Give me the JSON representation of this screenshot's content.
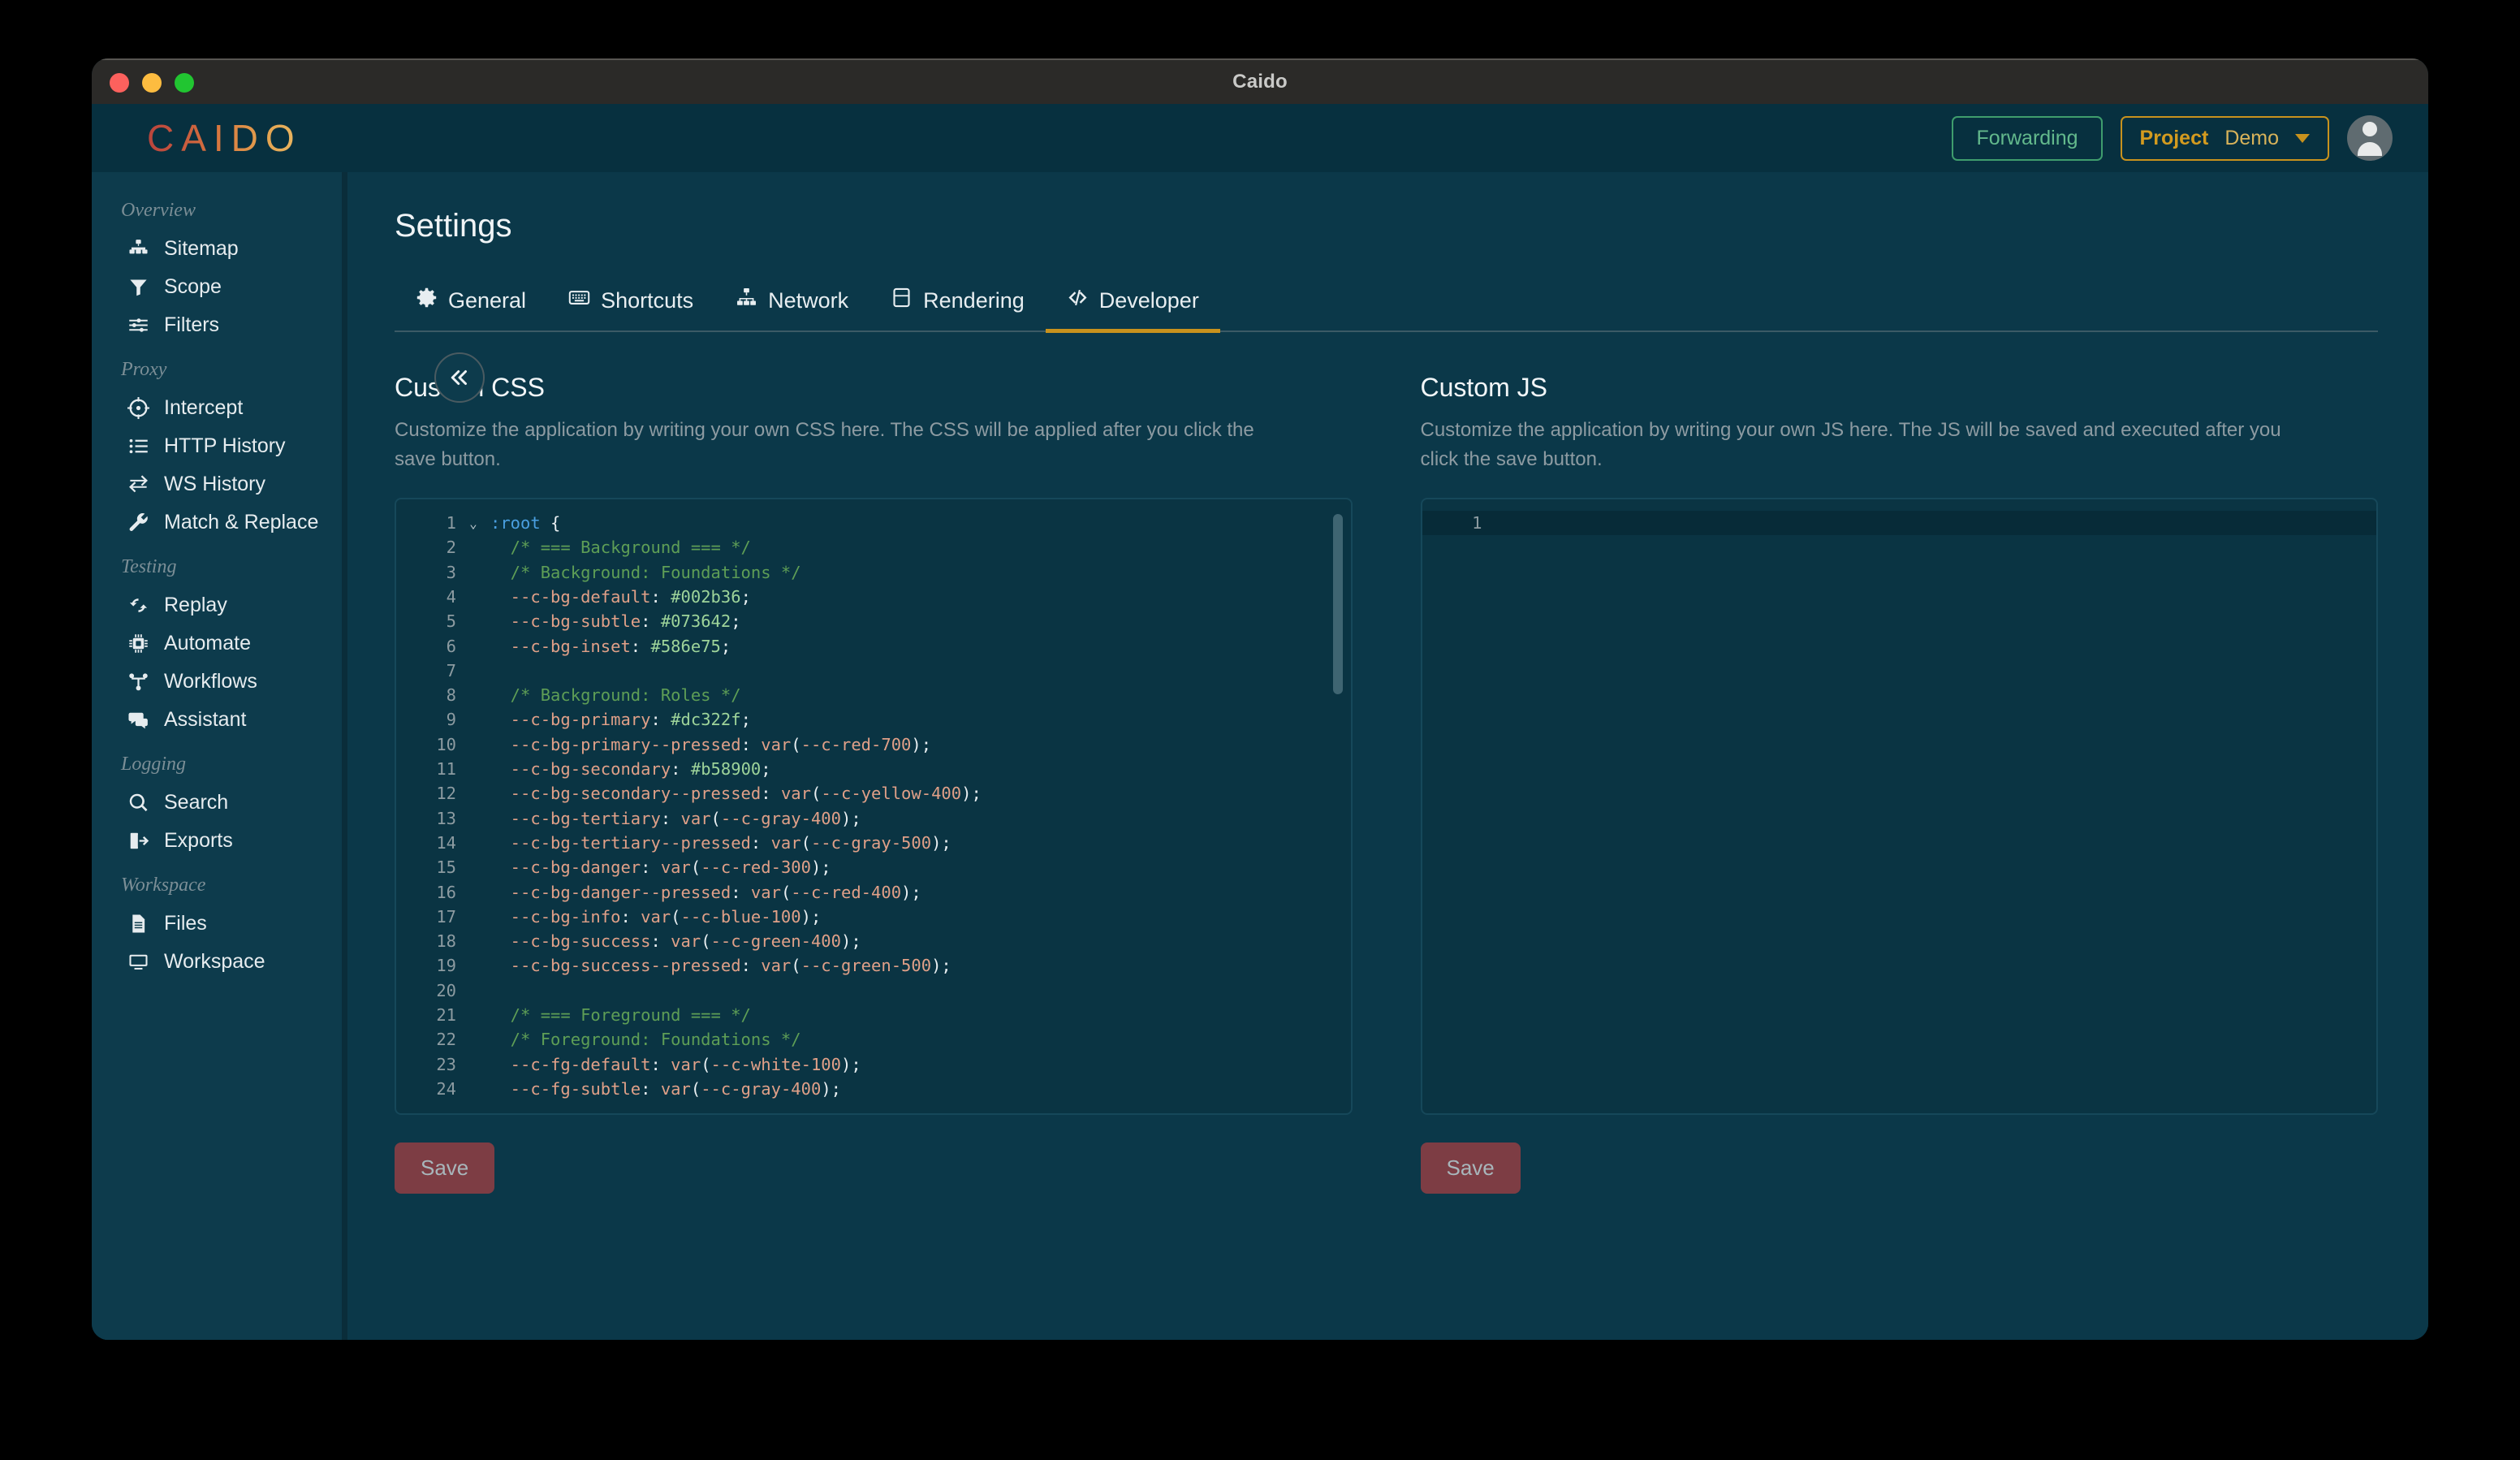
{
  "window": {
    "title": "Caido",
    "traffic_lights": [
      "close-red",
      "minimize-yellow",
      "maximize-green"
    ]
  },
  "header": {
    "logo_text": "CAIDO",
    "forwarding_label": "Forwarding",
    "project_label": "Project",
    "project_value": "Demo",
    "avatar_icon": "user-avatar-icon",
    "colors": {
      "forwarding_border": "#3f9d6d",
      "forwarding_text": "#63b98c",
      "project_border": "#c8921d",
      "project_key": "#d39b1f",
      "project_value": "#d8b35a"
    }
  },
  "sidebar": {
    "collapse_label": "«",
    "groups": [
      {
        "label": "Overview",
        "items": [
          {
            "label": "Sitemap",
            "icon": "sitemap-icon"
          },
          {
            "label": "Scope",
            "icon": "funnel-icon"
          },
          {
            "label": "Filters",
            "icon": "sliders-icon"
          }
        ]
      },
      {
        "label": "Proxy",
        "items": [
          {
            "label": "Intercept",
            "icon": "crosshair-icon"
          },
          {
            "label": "HTTP History",
            "icon": "list-icon"
          },
          {
            "label": "WS History",
            "icon": "exchange-arrows-icon"
          },
          {
            "label": "Match & Replace",
            "icon": "wrench-icon"
          }
        ]
      },
      {
        "label": "Testing",
        "items": [
          {
            "label": "Replay",
            "icon": "refresh-icon"
          },
          {
            "label": "Automate",
            "icon": "chip-icon"
          },
          {
            "label": "Workflows",
            "icon": "workflow-icon"
          },
          {
            "label": "Assistant",
            "icon": "chat-bubbles-icon"
          }
        ]
      },
      {
        "label": "Logging",
        "items": [
          {
            "label": "Search",
            "icon": "search-icon"
          },
          {
            "label": "Exports",
            "icon": "export-icon"
          }
        ]
      },
      {
        "label": "Workspace",
        "items": [
          {
            "label": "Files",
            "icon": "file-icon"
          },
          {
            "label": "Workspace",
            "icon": "monitor-icon"
          }
        ]
      }
    ]
  },
  "main": {
    "page_title": "Settings",
    "tabs": [
      {
        "label": "General",
        "icon": "gear-icon",
        "active": false
      },
      {
        "label": "Shortcuts",
        "icon": "keyboard-icon",
        "active": false
      },
      {
        "label": "Network",
        "icon": "network-icon",
        "active": false
      },
      {
        "label": "Rendering",
        "icon": "window-icon",
        "active": false
      },
      {
        "label": "Developer",
        "icon": "code-tags-icon",
        "active": true
      }
    ],
    "active_tab": "Developer",
    "active_tab_underline_color": "#c8921d",
    "panels": [
      {
        "title": "Custom CSS",
        "description": "Customize the application by writing your own CSS here. The CSS will be applied after you click the save button.",
        "save_label": "Save",
        "scrollbar_visible": true,
        "lines": [
          {
            "n": 1,
            "fold": "⌄",
            "tokens": [
              {
                "t": ":root",
                "c": "c-sel"
              },
              {
                "t": " {",
                "c": "c-punc"
              }
            ]
          },
          {
            "n": 2,
            "fold": "",
            "tokens": [
              {
                "t": "  /* === Background === */",
                "c": "c-com"
              }
            ]
          },
          {
            "n": 3,
            "fold": "",
            "tokens": [
              {
                "t": "  /* Background: Foundations */",
                "c": "c-com"
              }
            ]
          },
          {
            "n": 4,
            "fold": "",
            "tokens": [
              {
                "t": "  --c-bg-default",
                "c": "c-var"
              },
              {
                "t": ": ",
                "c": "c-punc"
              },
              {
                "t": "#002b36",
                "c": "c-val"
              },
              {
                "t": ";",
                "c": "c-punc"
              }
            ]
          },
          {
            "n": 5,
            "fold": "",
            "tokens": [
              {
                "t": "  --c-bg-subtle",
                "c": "c-var"
              },
              {
                "t": ": ",
                "c": "c-punc"
              },
              {
                "t": "#073642",
                "c": "c-val"
              },
              {
                "t": ";",
                "c": "c-punc"
              }
            ]
          },
          {
            "n": 6,
            "fold": "",
            "tokens": [
              {
                "t": "  --c-bg-inset",
                "c": "c-var"
              },
              {
                "t": ": ",
                "c": "c-punc"
              },
              {
                "t": "#586e75",
                "c": "c-val"
              },
              {
                "t": ";",
                "c": "c-punc"
              }
            ]
          },
          {
            "n": 7,
            "fold": "",
            "tokens": []
          },
          {
            "n": 8,
            "fold": "",
            "tokens": [
              {
                "t": "  /* Background: Roles */",
                "c": "c-com"
              }
            ]
          },
          {
            "n": 9,
            "fold": "",
            "tokens": [
              {
                "t": "  --c-bg-primary",
                "c": "c-var"
              },
              {
                "t": ": ",
                "c": "c-punc"
              },
              {
                "t": "#dc322f",
                "c": "c-val"
              },
              {
                "t": ";",
                "c": "c-punc"
              }
            ]
          },
          {
            "n": 10,
            "fold": "",
            "tokens": [
              {
                "t": "  --c-bg-primary--pressed",
                "c": "c-var"
              },
              {
                "t": ": ",
                "c": "c-punc"
              },
              {
                "t": "var",
                "c": "c-fn"
              },
              {
                "t": "(",
                "c": "c-punc"
              },
              {
                "t": "--c-red-700",
                "c": "c-var"
              },
              {
                "t": ");",
                "c": "c-punc"
              }
            ]
          },
          {
            "n": 11,
            "fold": "",
            "tokens": [
              {
                "t": "  --c-bg-secondary",
                "c": "c-var"
              },
              {
                "t": ": ",
                "c": "c-punc"
              },
              {
                "t": "#b58900",
                "c": "c-val"
              },
              {
                "t": ";",
                "c": "c-punc"
              }
            ]
          },
          {
            "n": 12,
            "fold": "",
            "tokens": [
              {
                "t": "  --c-bg-secondary--pressed",
                "c": "c-var"
              },
              {
                "t": ": ",
                "c": "c-punc"
              },
              {
                "t": "var",
                "c": "c-fn"
              },
              {
                "t": "(",
                "c": "c-punc"
              },
              {
                "t": "--c-yellow-400",
                "c": "c-var"
              },
              {
                "t": ");",
                "c": "c-punc"
              }
            ]
          },
          {
            "n": 13,
            "fold": "",
            "tokens": [
              {
                "t": "  --c-bg-tertiary",
                "c": "c-var"
              },
              {
                "t": ": ",
                "c": "c-punc"
              },
              {
                "t": "var",
                "c": "c-fn"
              },
              {
                "t": "(",
                "c": "c-punc"
              },
              {
                "t": "--c-gray-400",
                "c": "c-var"
              },
              {
                "t": ");",
                "c": "c-punc"
              }
            ]
          },
          {
            "n": 14,
            "fold": "",
            "tokens": [
              {
                "t": "  --c-bg-tertiary--pressed",
                "c": "c-var"
              },
              {
                "t": ": ",
                "c": "c-punc"
              },
              {
                "t": "var",
                "c": "c-fn"
              },
              {
                "t": "(",
                "c": "c-punc"
              },
              {
                "t": "--c-gray-500",
                "c": "c-var"
              },
              {
                "t": ");",
                "c": "c-punc"
              }
            ]
          },
          {
            "n": 15,
            "fold": "",
            "tokens": [
              {
                "t": "  --c-bg-danger",
                "c": "c-var"
              },
              {
                "t": ": ",
                "c": "c-punc"
              },
              {
                "t": "var",
                "c": "c-fn"
              },
              {
                "t": "(",
                "c": "c-punc"
              },
              {
                "t": "--c-red-300",
                "c": "c-var"
              },
              {
                "t": ");",
                "c": "c-punc"
              }
            ]
          },
          {
            "n": 16,
            "fold": "",
            "tokens": [
              {
                "t": "  --c-bg-danger--pressed",
                "c": "c-var"
              },
              {
                "t": ": ",
                "c": "c-punc"
              },
              {
                "t": "var",
                "c": "c-fn"
              },
              {
                "t": "(",
                "c": "c-punc"
              },
              {
                "t": "--c-red-400",
                "c": "c-var"
              },
              {
                "t": ");",
                "c": "c-punc"
              }
            ]
          },
          {
            "n": 17,
            "fold": "",
            "tokens": [
              {
                "t": "  --c-bg-info",
                "c": "c-var"
              },
              {
                "t": ": ",
                "c": "c-punc"
              },
              {
                "t": "var",
                "c": "c-fn"
              },
              {
                "t": "(",
                "c": "c-punc"
              },
              {
                "t": "--c-blue-100",
                "c": "c-var"
              },
              {
                "t": ");",
                "c": "c-punc"
              }
            ]
          },
          {
            "n": 18,
            "fold": "",
            "tokens": [
              {
                "t": "  --c-bg-success",
                "c": "c-var"
              },
              {
                "t": ": ",
                "c": "c-punc"
              },
              {
                "t": "var",
                "c": "c-fn"
              },
              {
                "t": "(",
                "c": "c-punc"
              },
              {
                "t": "--c-green-400",
                "c": "c-var"
              },
              {
                "t": ");",
                "c": "c-punc"
              }
            ]
          },
          {
            "n": 19,
            "fold": "",
            "tokens": [
              {
                "t": "  --c-bg-success--pressed",
                "c": "c-var"
              },
              {
                "t": ": ",
                "c": "c-punc"
              },
              {
                "t": "var",
                "c": "c-fn"
              },
              {
                "t": "(",
                "c": "c-punc"
              },
              {
                "t": "--c-green-500",
                "c": "c-var"
              },
              {
                "t": ");",
                "c": "c-punc"
              }
            ]
          },
          {
            "n": 20,
            "fold": "",
            "tokens": []
          },
          {
            "n": 21,
            "fold": "",
            "tokens": [
              {
                "t": "  /* === Foreground === */",
                "c": "c-com"
              }
            ]
          },
          {
            "n": 22,
            "fold": "",
            "tokens": [
              {
                "t": "  /* Foreground: Foundations */",
                "c": "c-com"
              }
            ]
          },
          {
            "n": 23,
            "fold": "",
            "tokens": [
              {
                "t": "  --c-fg-default",
                "c": "c-var"
              },
              {
                "t": ": ",
                "c": "c-punc"
              },
              {
                "t": "var",
                "c": "c-fn"
              },
              {
                "t": "(",
                "c": "c-punc"
              },
              {
                "t": "--c-white-100",
                "c": "c-var"
              },
              {
                "t": ");",
                "c": "c-punc"
              }
            ]
          },
          {
            "n": 24,
            "fold": "",
            "tokens": [
              {
                "t": "  --c-fg-subtle",
                "c": "c-var"
              },
              {
                "t": ": ",
                "c": "c-punc"
              },
              {
                "t": "var",
                "c": "c-fn"
              },
              {
                "t": "(",
                "c": "c-punc"
              },
              {
                "t": "--c-gray-400",
                "c": "c-var"
              },
              {
                "t": ");",
                "c": "c-punc"
              }
            ]
          }
        ]
      },
      {
        "title": "Custom JS",
        "description": "Customize the application by writing your own JS here. The JS will be saved and executed after you click the save button.",
        "save_label": "Save",
        "scrollbar_visible": false,
        "lines": [
          {
            "n": 1,
            "fold": "",
            "tokens": [],
            "active": true
          }
        ]
      }
    ]
  },
  "colors": {
    "page_background": "#000000",
    "window_titlebar": "#2b2a28",
    "app_background": "#07303f",
    "sidebar_background": "#0d3b4c",
    "main_background": "#0b3849",
    "editor_background": "#0a3443",
    "accent_amber": "#c8921d",
    "save_button": "#7d3d44"
  }
}
